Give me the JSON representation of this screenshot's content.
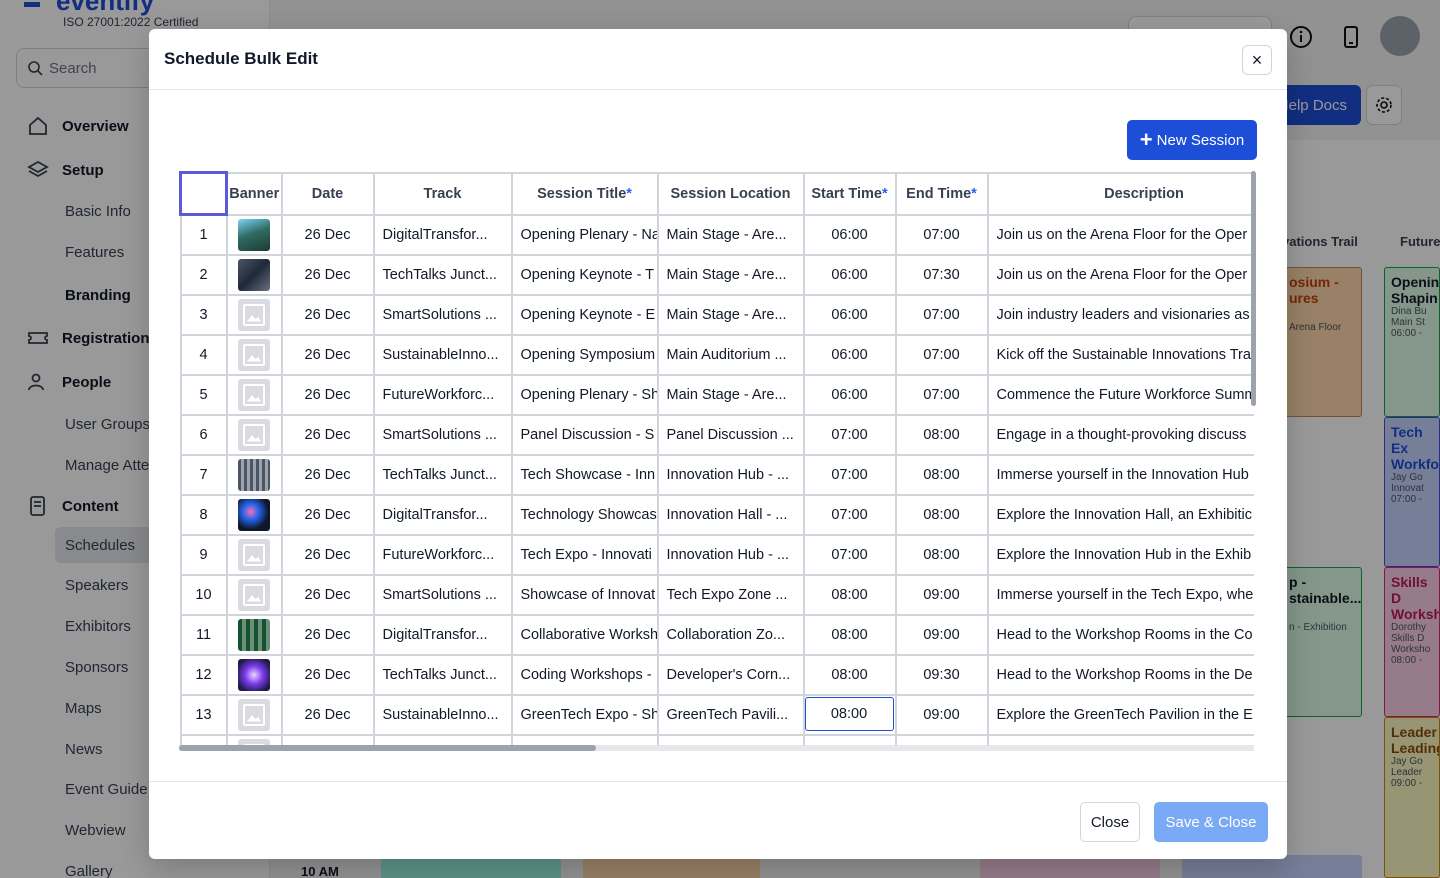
{
  "app": {
    "logo": "eventify",
    "cert": "ISO 27001:2022 Certified",
    "search_placeholder": "Search",
    "help_docs": "Help Docs",
    "nav": [
      {
        "label": "Overview",
        "type": "section",
        "icon": "home-icon"
      },
      {
        "label": "Setup",
        "type": "section",
        "icon": "layers-icon"
      },
      {
        "label": "Basic Info",
        "type": "sub"
      },
      {
        "label": "Features",
        "type": "sub"
      },
      {
        "label": "Branding",
        "type": "subbold"
      },
      {
        "label": "Registration",
        "type": "section",
        "icon": "ticket-icon"
      },
      {
        "label": "People",
        "type": "section",
        "icon": "people-icon"
      },
      {
        "label": "User Groups",
        "type": "sub"
      },
      {
        "label": "Manage Atte",
        "type": "sub"
      },
      {
        "label": "Content",
        "type": "section",
        "icon": "content-icon"
      },
      {
        "label": "Schedules",
        "type": "active"
      },
      {
        "label": "Speakers",
        "type": "sub"
      },
      {
        "label": "Exhibitors",
        "type": "sub"
      },
      {
        "label": "Sponsors",
        "type": "sub"
      },
      {
        "label": "Maps",
        "type": "sub"
      },
      {
        "label": "News",
        "type": "sub"
      },
      {
        "label": "Event Guide",
        "type": "sub"
      },
      {
        "label": "Webview",
        "type": "sub"
      },
      {
        "label": "Gallery",
        "type": "sub"
      }
    ],
    "bg_headers": [
      "vations Trail",
      "Future"
    ],
    "bg_time": "10 AM",
    "bg_cards": [
      {
        "title": "osium - ures",
        "meta": "Arena Floor"
      },
      {
        "title": "Openin Shapin",
        "meta1": "Dina Bu",
        "meta2": "Main St",
        "meta3": "06:00 -"
      },
      {
        "title": "Tech Ex Workfo",
        "meta1": "Jay Go",
        "meta2": "Innovat",
        "meta3": "07:00 -"
      },
      {
        "title": "p - stainable...",
        "meta": "n - Exhibition"
      },
      {
        "title": "Skills D Worksh",
        "meta1": "Dorothy",
        "meta2": "Skills D Worksho",
        "meta3": "08:00 -"
      },
      {
        "title": "Leader Leading",
        "meta1": "Jay Go",
        "meta2": "Leader",
        "meta3": "09:00 -"
      }
    ]
  },
  "modal": {
    "title": "Schedule Bulk Edit",
    "close_x": "×",
    "new_session": "New Session",
    "close": "Close",
    "save_close": "Save & Close",
    "columns": [
      {
        "label": "",
        "req": ""
      },
      {
        "label": "Banner",
        "req": ""
      },
      {
        "label": "Date",
        "req": ""
      },
      {
        "label": "Track",
        "req": ""
      },
      {
        "label": "Session Title",
        "req": "*"
      },
      {
        "label": "Session Location",
        "req": ""
      },
      {
        "label": "Start Time",
        "req": "*"
      },
      {
        "label": "End Time",
        "req": "*"
      },
      {
        "label": "Description",
        "req": ""
      }
    ],
    "rows": [
      {
        "n": "1",
        "banner": "img-forest",
        "date": "26 Dec",
        "track": "DigitalTransfor...",
        "title": "Opening Plenary - Na",
        "location": "Main Stage - Are...",
        "start": "06:00",
        "end": "07:00",
        "desc": "Join us on the Arena Floor for the Oper"
      },
      {
        "n": "2",
        "banner": "img-dark",
        "date": "26 Dec",
        "track": "TechTalks Junct...",
        "title": "Opening Keynote - T",
        "location": "Main Stage - Are...",
        "start": "06:00",
        "end": "07:30",
        "desc": "Join us on the Arena Floor for the Oper"
      },
      {
        "n": "3",
        "banner": "placeholder",
        "date": "26 Dec",
        "track": "SmartSolutions ...",
        "title": "Opening Keynote - E",
        "location": "Main Stage - Are...",
        "start": "06:00",
        "end": "07:00",
        "desc": "Join industry leaders and visionaries as"
      },
      {
        "n": "4",
        "banner": "placeholder",
        "date": "26 Dec",
        "track": "SustainableInno...",
        "title": "Opening Symposium",
        "location": "Main Auditorium ...",
        "start": "06:00",
        "end": "07:00",
        "desc": "Kick off the Sustainable Innovations Tra"
      },
      {
        "n": "5",
        "banner": "placeholder",
        "date": "26 Dec",
        "track": "FutureWorkforc...",
        "title": "Opening Plenary - Sh",
        "location": "Main Stage - Are...",
        "start": "06:00",
        "end": "07:00",
        "desc": "Commence the Future Workforce Summ"
      },
      {
        "n": "6",
        "banner": "placeholder",
        "date": "26 Dec",
        "track": "SmartSolutions ...",
        "title": "Panel Discussion - S",
        "location": "Panel Discussion ...",
        "start": "07:00",
        "end": "08:00",
        "desc": "Engage in a thought-provoking discuss"
      },
      {
        "n": "7",
        "banner": "img-gray",
        "date": "26 Dec",
        "track": "TechTalks Junct...",
        "title": "Tech Showcase - Inn",
        "location": "Innovation Hub - ...",
        "start": "07:00",
        "end": "08:00",
        "desc": "Immerse yourself in the Innovation Hub"
      },
      {
        "n": "8",
        "banner": "img-neon",
        "date": "26 Dec",
        "track": "DigitalTransfor...",
        "title": "Technology Showcas",
        "location": "Innovation Hall - ...",
        "start": "07:00",
        "end": "08:00",
        "desc": "Explore the Innovation Hall, an Exhibitic"
      },
      {
        "n": "9",
        "banner": "placeholder",
        "date": "26 Dec",
        "track": "FutureWorkforc...",
        "title": "Tech Expo - Innovati",
        "location": "Innovation Hub - ...",
        "start": "07:00",
        "end": "08:00",
        "desc": "Explore the Innovation Hub in the Exhib"
      },
      {
        "n": "10",
        "banner": "placeholder",
        "date": "26 Dec",
        "track": "SmartSolutions ...",
        "title": "Showcase of Innovat",
        "location": "Tech Expo Zone ...",
        "start": "08:00",
        "end": "09:00",
        "desc": "Immerse yourself in the Tech Expo, whe"
      },
      {
        "n": "11",
        "banner": "img-green",
        "date": "26 Dec",
        "track": "DigitalTransfor...",
        "title": "Collaborative Worksh",
        "location": "Collaboration Zo...",
        "start": "08:00",
        "end": "09:00",
        "desc": "Head to the Workshop Rooms in the Co"
      },
      {
        "n": "12",
        "banner": "img-purple",
        "date": "26 Dec",
        "track": "TechTalks Junct...",
        "title": "Coding Workshops -",
        "location": "Developer's Corn...",
        "start": "08:00",
        "end": "09:30",
        "desc": "Head to the Workshop Rooms in the De"
      },
      {
        "n": "13",
        "banner": "placeholder",
        "date": "26 Dec",
        "track": "SustainableInno...",
        "title": "GreenTech Expo - Sh",
        "location": "GreenTech Pavili...",
        "start": "08:00",
        "end": "09:00",
        "desc": "Explore the GreenTech Pavilion in the E",
        "selected": true
      },
      {
        "n": "",
        "banner": "placeholder",
        "date": "",
        "track": "",
        "title": "",
        "location": "",
        "start": "",
        "end": "",
        "desc": ""
      }
    ]
  },
  "colors": {
    "primary": "#1d4ed8",
    "save_disabled": "#7aaaf5",
    "required": "#2563eb",
    "selection": "#5b5bd6"
  }
}
